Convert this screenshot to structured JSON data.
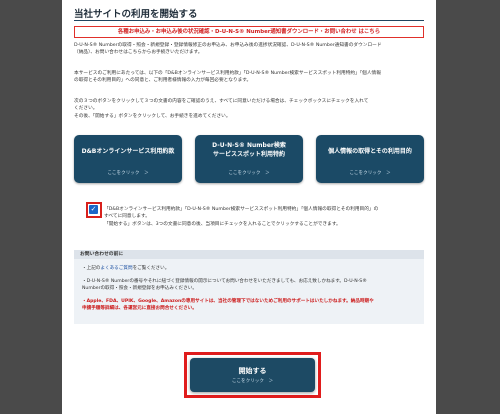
{
  "page": {
    "title": "当社サイトの利用を開始する",
    "notice": "各種お申込み・お申込み後の状況確認・D-U-N-S® Number通知書ダウンロード・お問い合わせ はこちら",
    "paragraph1_line1": "D-U-N-S® Numberの取得・照会・新規登録・登録情報修正のお申込み、お申込み後の進捗状況確認、D-U-N-S® Number通知書のダウンロード",
    "paragraph1_line2": "（納品）、お問い合わせはこちらからお手続きいただけます。",
    "paragraph2_line1": "本サービスのご利用にあたっては、以下の「D&Bオンラインサービス利用約款」「D-U-N-S® Number検索サービススポット利用特約」「個人情報",
    "paragraph2_line2": "の取得とその利用目的」への同意と、ご利用者様情報の入力が毎回必要となります。",
    "paragraph3_line1": "次の３つのボタンをクリックして３つの文書の内容をご確認のうえ、すべてに同意いただける場合は、チェックボックスにチェックを入れて",
    "paragraph3_line2": "ください。",
    "paragraph3_line3": "その後、「開始する」ボタンをクリックして、お手続きを進めてください。"
  },
  "cards": [
    {
      "title": "D&Bオンラインサービス利用約款",
      "click": "ここをクリック　＞"
    },
    {
      "title_line1": "D-U-N-S® Number検索",
      "title_line2": "サービススポット利用特約",
      "click": "ここをクリック　＞"
    },
    {
      "title": "個人情報の取得とその利用目的",
      "click": "ここをクリック　＞"
    }
  ],
  "agreement": {
    "checked": true,
    "check_mark": "✓",
    "line1": "「D&Bオンラインサービス利用約款」「D-U-N-S® Number検索サービススポット利用特約」「個人情報の取得とその利用目的」の",
    "line2": "すべてに同意します。",
    "line3": "「開始する」ボタンは、3つの文書に同意の後、当項目にチェックを入れることでクリックすることができます。"
  },
  "contact": {
    "heading": "お問い合わせの前に",
    "line1_prefix": "・上記の",
    "line1_link": "よくあるご質問",
    "line1_suffix": "をご覧ください。",
    "line2a": "・D-U-N-S® Numberの番号やそれに紐づく登録情報の開示についてお問い合わせをいただきましても、お応え致しかねます。D-U-N-S®",
    "line2b": "Numberの取得・照会・新規登録をお申込みください。",
    "line3a": "・Apple、FDA、UPIK、Google、Amazonの専用サイトは、当社の管理下ではないためご利用のサポートはいたしかねます。納品時期や",
    "line3b": "申請手順等詳細は、各運営元に直接お問合せください。"
  },
  "start_button": {
    "label": "開始する",
    "click": "ここをクリック　＞"
  }
}
